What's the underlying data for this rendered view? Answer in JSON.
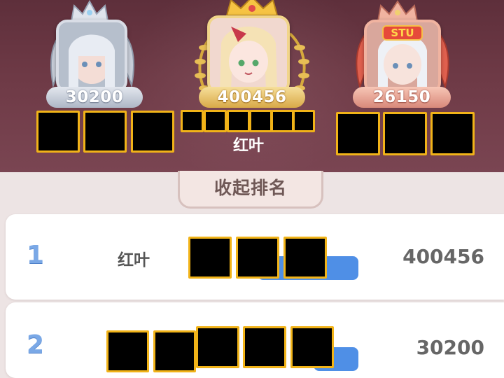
{
  "podium": {
    "second": {
      "score": "30200"
    },
    "first": {
      "score": "400456",
      "name": "红叶"
    },
    "third": {
      "score": "26150",
      "badge": "STU"
    }
  },
  "collapse_label": "收起排名",
  "rankings": [
    {
      "rank": "1",
      "name": "红叶",
      "score": "400456"
    },
    {
      "rank": "2",
      "name": "",
      "score": "30200"
    }
  ],
  "colors": {
    "podium_bg": "#6e3a46",
    "rank_accent": "#7aa8e6",
    "bar": "#4f8fe6",
    "redaction_border": "#f1b318"
  },
  "icons": [
    "crown-icon",
    "laurel-icon",
    "wing-icon",
    "avatar"
  ]
}
